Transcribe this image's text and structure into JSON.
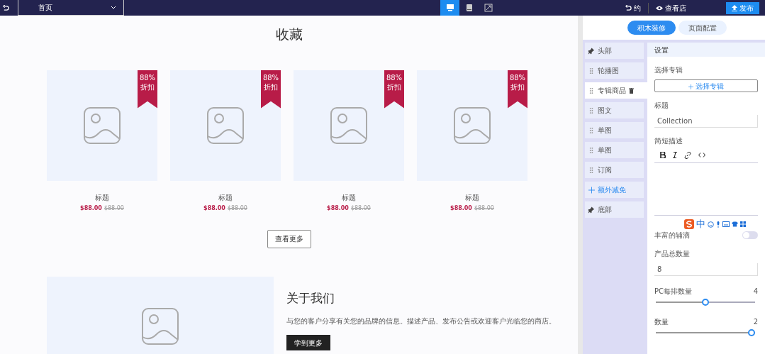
{
  "topbar": {
    "page_select": "首页",
    "devices": [
      {
        "kind": "desktop",
        "selected": true
      },
      {
        "kind": "tablet",
        "selected": false
      },
      {
        "kind": "fullscreen",
        "selected": false
      }
    ],
    "undo": "约",
    "view_store": "查看店",
    "publish": "发布"
  },
  "canvas": {
    "collection_title": "收藏",
    "products": [
      {
        "badge": "88%",
        "badge_sub": "折扣",
        "title": "标题",
        "price": "$88.00",
        "old_price": "$88.00"
      },
      {
        "badge": "88%",
        "badge_sub": "折扣",
        "title": "标题",
        "price": "$88.00",
        "old_price": "$88.00"
      },
      {
        "badge": "88%",
        "badge_sub": "折扣",
        "title": "标题",
        "price": "$88.00",
        "old_price": "$88.00"
      },
      {
        "badge": "88%",
        "badge_sub": "折扣",
        "title": "标题",
        "price": "$88.00",
        "old_price": "$88.00"
      }
    ],
    "more_button": "查看更多",
    "about": {
      "title": "关于我们",
      "text": "与您的客户分享有关您的品牌的信息。描述产品、发布公告或欢迎客户光临您的商店。",
      "button": "学到更多"
    }
  },
  "panel": {
    "tabs": [
      {
        "label": "积木装修",
        "selected": true
      },
      {
        "label": "页面配置",
        "selected": false
      }
    ],
    "sections": [
      {
        "kind": "pinned",
        "label": "头部",
        "selected": false
      },
      {
        "kind": "drag",
        "label": "轮播图",
        "selected": false
      },
      {
        "kind": "drag",
        "label": "专辑商品",
        "selected": true
      },
      {
        "kind": "drag",
        "label": "图文",
        "selected": false
      },
      {
        "kind": "drag",
        "label": "单图",
        "selected": false
      },
      {
        "kind": "drag",
        "label": "单图",
        "selected": false
      },
      {
        "kind": "drag",
        "label": "订阅",
        "selected": false
      },
      {
        "kind": "add",
        "label": "额外减免",
        "selected": false
      },
      {
        "kind": "pinned",
        "label": "底部",
        "selected": false
      }
    ],
    "settings": {
      "header": "设置",
      "album_label": "选择专辑",
      "album_button": "选择专辑",
      "title_label": "标题",
      "title_value": "Collection",
      "desc_label": "简短描述",
      "toggle_label": "丰富的辅滴",
      "toggle_on": false,
      "count_label": "产品总数量",
      "count_value": "8",
      "sliders": [
        {
          "label": "PC每排数量",
          "reading": "4",
          "level": 0.5
        },
        {
          "label": "数量",
          "reading": "2",
          "level": 1
        }
      ]
    }
  },
  "ime_bar": {
    "mode": "中"
  }
}
